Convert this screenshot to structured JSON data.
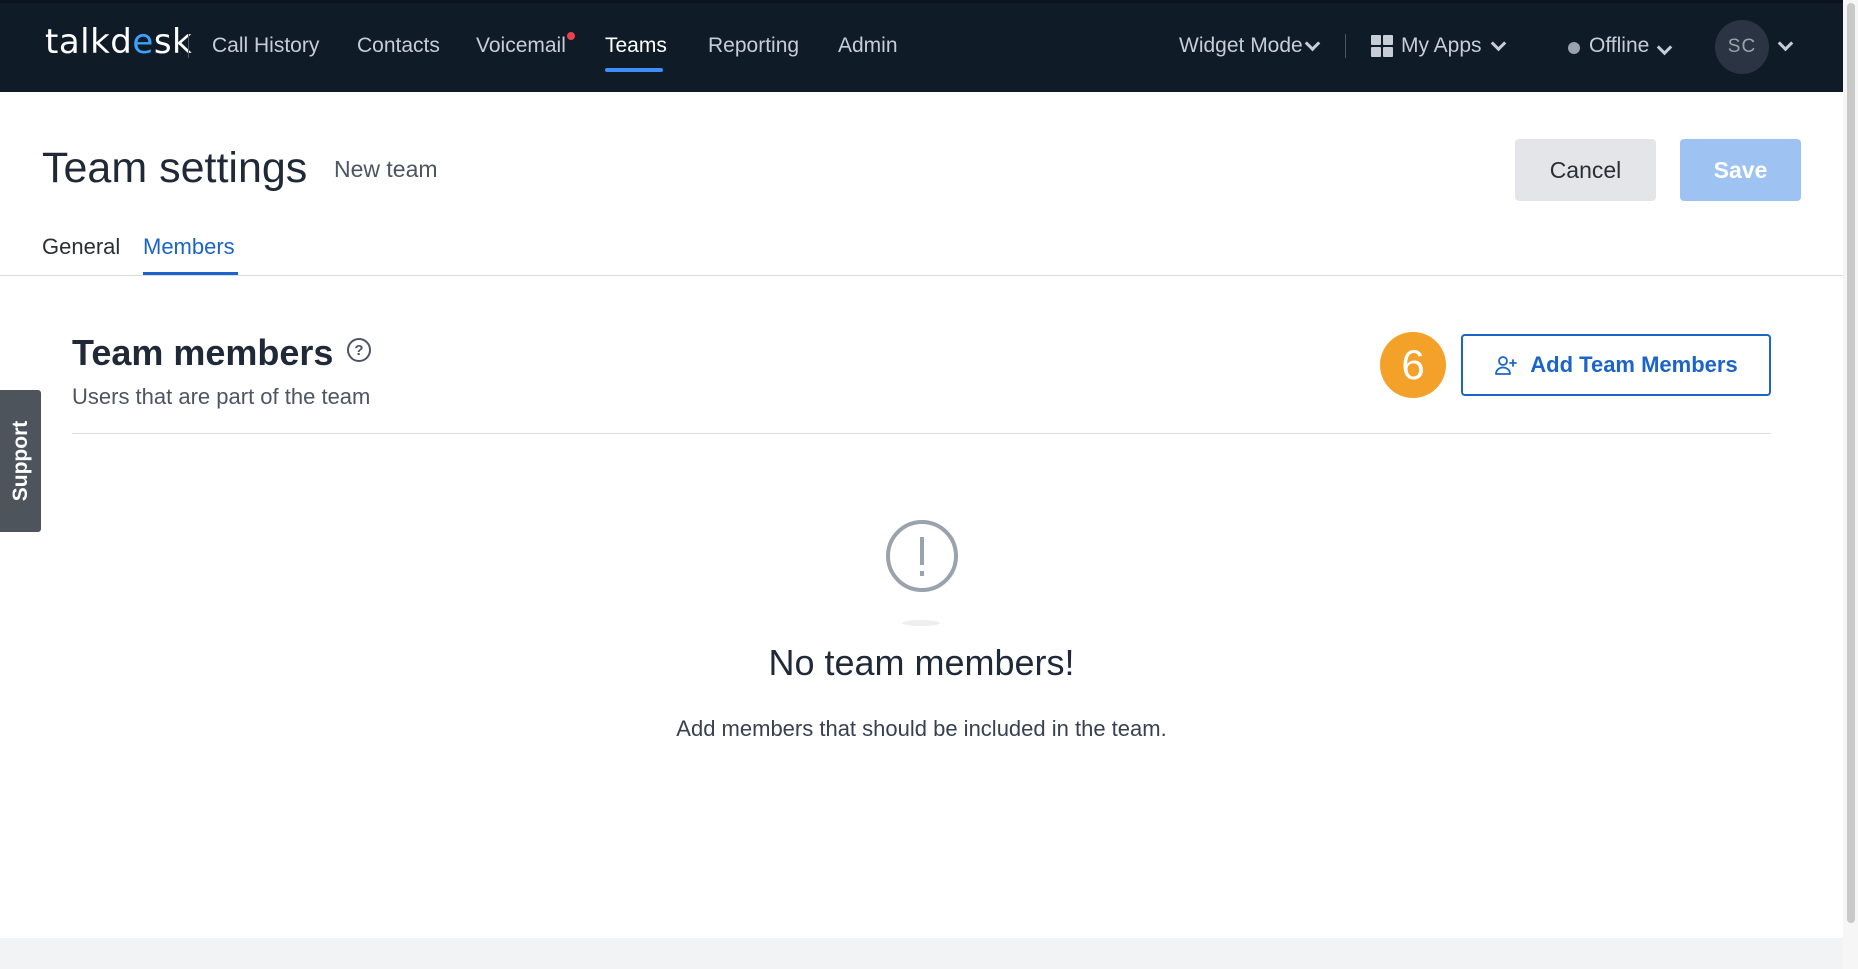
{
  "nav": {
    "logo": {
      "prefix": "talkd",
      "accent": "e",
      "suffix": "sk"
    },
    "items": [
      {
        "label": "Call History"
      },
      {
        "label": "Contacts"
      },
      {
        "label": "Voicemail"
      },
      {
        "label": "Teams"
      },
      {
        "label": "Reporting"
      },
      {
        "label": "Admin"
      }
    ],
    "active_item": "Teams",
    "widget_mode": "Widget Mode",
    "my_apps": "My Apps",
    "status": "Offline",
    "avatar_initials": "SC"
  },
  "header": {
    "title": "Team settings",
    "subtitle": "New team",
    "cancel_label": "Cancel",
    "save_label": "Save"
  },
  "tabs": [
    {
      "label": "General"
    },
    {
      "label": "Members"
    }
  ],
  "active_tab": "Members",
  "support": {
    "label": "Support"
  },
  "section": {
    "title": "Team members",
    "help_glyph": "?",
    "description": "Users that are part of the team",
    "step_badge": "6",
    "add_button_label": "Add Team Members"
  },
  "empty_state": {
    "title": "No team members!",
    "description": "Add members that should be included in the team."
  },
  "colors": {
    "topbar": "#101b28",
    "accent_blue": "#1b64c8",
    "save_disabled": "#9ec3f2",
    "step_badge": "#f4a12a",
    "notification_dot": "#e8434c"
  }
}
